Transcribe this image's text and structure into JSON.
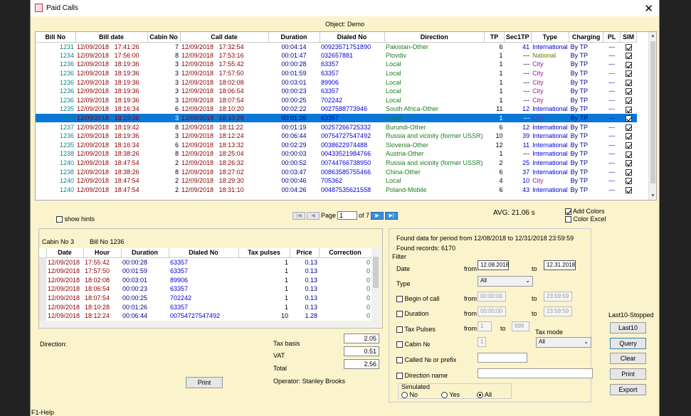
{
  "window": {
    "title": "Paid Calls",
    "close_glyph": "✕"
  },
  "object_label": "Object: Demo",
  "main_table": {
    "columns": [
      "Bill No",
      "Bill date",
      "Cabin No",
      "Call date",
      "Duration",
      "Dialed No",
      "Direction",
      "TP",
      "Sec1TP",
      "Type",
      "Charging",
      "PL",
      "SIM"
    ],
    "rows": [
      [
        "1231",
        "12/09/2018",
        "17:41:26",
        "7",
        "12/09/2018",
        "17:32:54",
        "00:04:14",
        "00923571751890",
        "Pakistan-Other",
        "6",
        "41",
        "International",
        "By TP",
        "---"
      ],
      [
        "1234",
        "12/09/2018",
        "17:56:00",
        "8",
        "12/09/2018",
        "17:53:16",
        "00:01:47",
        "032657881",
        "Plovdiv",
        "1",
        "---",
        "National",
        "By TP",
        "---"
      ],
      [
        "1236",
        "12/09/2018",
        "18:19:36",
        "3",
        "12/09/2018",
        "17:55:42",
        "00:00:28",
        "63357",
        "Local",
        "1",
        "---",
        "City",
        "By TP",
        "---"
      ],
      [
        "1236",
        "12/09/2018",
        "18:19:36",
        "3",
        "12/09/2018",
        "17:57:50",
        "00:01:59",
        "63357",
        "Local",
        "1",
        "---",
        "City",
        "By TP",
        "---"
      ],
      [
        "1236",
        "12/09/2018",
        "18:19:36",
        "3",
        "12/09/2018",
        "18:02:08",
        "00:03:01",
        "89906",
        "Local",
        "1",
        "---",
        "City",
        "By TP",
        "---"
      ],
      [
        "1236",
        "12/09/2018",
        "18:19:36",
        "3",
        "12/09/2018",
        "18:06:54",
        "00:00:23",
        "63357",
        "Local",
        "1",
        "---",
        "City",
        "By TP",
        "---"
      ],
      [
        "1236",
        "12/09/2018",
        "18:19:36",
        "3",
        "12/09/2018",
        "18:07:54",
        "00:00:25",
        "702242",
        "Local",
        "1",
        "---",
        "City",
        "By TP",
        "---"
      ],
      [
        "1235",
        "12/09/2018",
        "18:16:34",
        "6",
        "12/09/2018",
        "18:10:20",
        "00:02:22",
        "0027588773946",
        "South Africa-Other",
        "11",
        "12",
        "International",
        "By TP",
        "---"
      ],
      [
        "1236",
        "12/09/2018",
        "18:19:36",
        "3",
        "12/09/2018",
        "18:10:28",
        "00:01:26",
        "63357",
        "Local",
        "1",
        "---",
        "City",
        "By TP",
        "---"
      ],
      [
        "1237",
        "12/09/2018",
        "18:19:42",
        "8",
        "12/09/2018",
        "18:11:22",
        "00:01:19",
        "00257266725332",
        "Burundi-Other",
        "6",
        "12",
        "International",
        "By TP",
        "---"
      ],
      [
        "1236",
        "12/09/2018",
        "18:19:36",
        "3",
        "12/09/2018",
        "18:12:24",
        "00:06:44",
        "00754727547492",
        "Russia and vicinity (former USSR)",
        "10",
        "39",
        "International",
        "By TP",
        "---"
      ],
      [
        "1235",
        "12/09/2018",
        "18:16:34",
        "6",
        "12/09/2018",
        "18:13:32",
        "00:02:29",
        "0038622974488",
        "Slovenia-Other",
        "12",
        "11",
        "International",
        "By TP",
        "---"
      ],
      [
        "1238",
        "12/09/2018",
        "18:38:26",
        "8",
        "12/09/2018",
        "18:25:04",
        "00:00:03",
        "00433521984766",
        "Austria-Other",
        "1",
        "---",
        "International",
        "By TP",
        "---"
      ],
      [
        "1240",
        "12/09/2018",
        "18:47:54",
        "2",
        "12/09/2018",
        "18:26:32",
        "00:00:52",
        "00744766738950",
        "Russia and vicinity (former USSR)",
        "2",
        "25",
        "International",
        "By TP",
        "---"
      ],
      [
        "1238",
        "12/09/2018",
        "18:38:26",
        "8",
        "12/09/2018",
        "18:27:02",
        "00:03:47",
        "00863585755466",
        "China-Other",
        "6",
        "37",
        "International",
        "By TP",
        "---"
      ],
      [
        "1240",
        "12/09/2018",
        "18:47:54",
        "2",
        "12/09/2018",
        "18:29:30",
        "00:00:46",
        "705362",
        "Local",
        "4",
        "10",
        "City",
        "By TP",
        "---"
      ],
      [
        "1240",
        "12/09/2018",
        "18:47:54",
        "2",
        "12/09/2018",
        "18:31:10",
        "00:04:26",
        "00487535621558",
        "Poland-Mobile",
        "6",
        "43",
        "International",
        "By TP",
        "---"
      ]
    ],
    "selected_index": 8
  },
  "show_hints": "show hints",
  "pager": {
    "page_label": "Page",
    "page_value": "1",
    "of_label": "of 7"
  },
  "avg": "AVG:  21.06 s",
  "add_colors": "Add Colors",
  "color_excel": "Color Excel",
  "detail": {
    "cabin": "Cabin No 3",
    "bill": "Bill No 1236",
    "columns": [
      "Date",
      "Hour",
      "Duration",
      "Dialed No",
      "Tax pulses",
      "Price",
      "Correction"
    ],
    "rows": [
      [
        "12/09/2018",
        "17:55:42",
        "00:00:28",
        "63357",
        "1",
        "0.13",
        "0"
      ],
      [
        "12/09/2018",
        "17:57:50",
        "00:01:59",
        "63357",
        "1",
        "0.13",
        "0"
      ],
      [
        "12/09/2018",
        "18:02:08",
        "00:03:01",
        "89906",
        "1",
        "0.13",
        "0"
      ],
      [
        "12/09/2018",
        "18:06:54",
        "00:00:23",
        "63357",
        "1",
        "0.13",
        "0"
      ],
      [
        "12/09/2018",
        "18:07:54",
        "00:00:25",
        "702242",
        "1",
        "0.13",
        "0"
      ],
      [
        "12/09/2018",
        "18:10:28",
        "00:01:26",
        "63357",
        "1",
        "0.13",
        "0"
      ],
      [
        "12/09/2018",
        "18:12:24",
        "00:06:44",
        "00754727547492",
        "10",
        "1.28",
        "0"
      ]
    ]
  },
  "direction_label": "Direction:",
  "tax_basis_label": "Tax basis",
  "tax_basis": "2.05",
  "vat_label": "VAT",
  "vat": "0.51",
  "total_label": "Total",
  "total": "2.56",
  "print_label": "Print",
  "operator": "Operator: Stanley Brooks",
  "found_period": "Found data for period from 12/08/2018 to 12/31/2018 23:59:59",
  "found_records": "Found records: 6170",
  "filter": {
    "title": "Filter",
    "date_label": "Date",
    "from": "from",
    "to": "to",
    "date_from": "12.08.2018",
    "date_to": "12.31.2018",
    "type_label": "Type",
    "type_value": "All",
    "begin_label": "Begin of call",
    "begin_from": "00:00:00",
    "begin_to": "23:59:59",
    "duration_label": "Duration",
    "dur_from": "00:00:00",
    "dur_to": "23:59:59",
    "pulses_label": "Tax Pulses",
    "pulses_from": "1",
    "pulses_to": "999",
    "tax_mode_label": "Tax mode",
    "tax_mode_value": "All",
    "cabin_label": "Cabin №",
    "cabin_value": "1",
    "called_label": "Called № or prefix",
    "dirname_label": "Direction name",
    "simulated_label": "Simulated",
    "sim_no": "No",
    "sim_yes": "Yes",
    "sim_all": "All"
  },
  "side": {
    "last10_label": "Last10-Stopped",
    "last10": "Last10",
    "query": "Query",
    "clear": "Clear",
    "print": "Print",
    "export": "Export"
  },
  "status_bar": "F1-Help"
}
